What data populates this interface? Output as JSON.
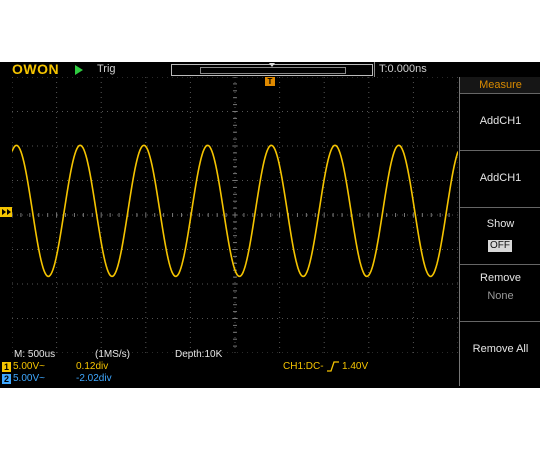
{
  "brand": "OWON",
  "header": {
    "trigger_status": "Trig",
    "trigger_time": "T:0.000ns"
  },
  "menu": {
    "title": "Measure",
    "items": [
      {
        "label": "AddCH1"
      },
      {
        "label": "AddCH1"
      },
      {
        "label": "Show",
        "value": "OFF"
      },
      {
        "label": "Remove",
        "sub": "None"
      },
      {
        "label": "Remove All"
      }
    ]
  },
  "status": {
    "timebase": "M: 500us",
    "sample_rate": "(1MS/s)",
    "depth": "Depth:10K",
    "trigger_info": "CH1:DC-",
    "trigger_level": "1.40V",
    "ch1": {
      "num": "1",
      "volts": "5.00V~",
      "pos": "0.12div"
    },
    "ch2": {
      "num": "2",
      "volts": "5.00V~",
      "pos": "-2.02div"
    }
  },
  "waveform": {
    "color": "#f5c400",
    "cycles": 7,
    "amplitude_div": 2,
    "offset_div": 0.12
  },
  "colors": {
    "ch1": "#f5c400",
    "ch2": "#3fa8ff",
    "accent": "#d88a00"
  }
}
